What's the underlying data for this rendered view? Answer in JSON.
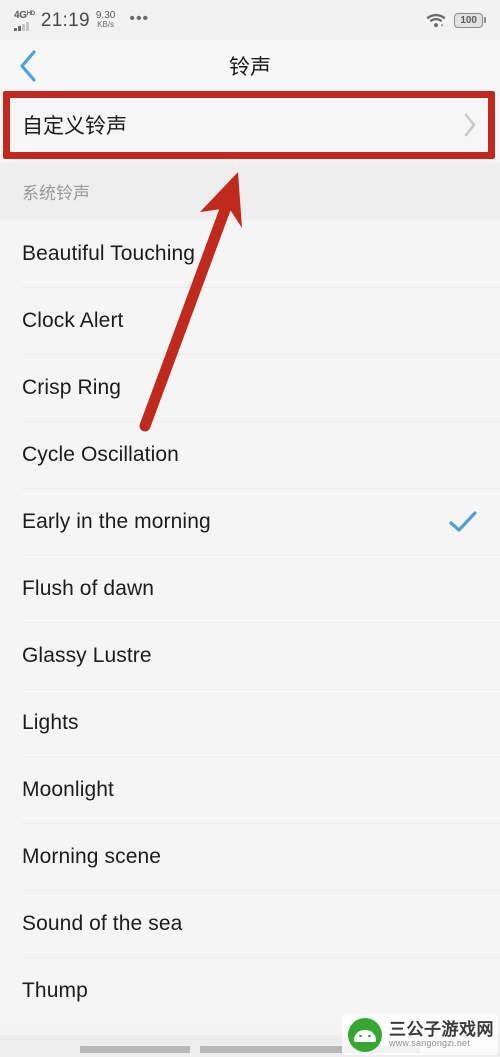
{
  "status_bar": {
    "network_type": "4G",
    "network_sup": "HD",
    "time": "21:19",
    "net_speed_value": "9.30",
    "net_speed_unit": "KB/s",
    "overflow_dots": "•••",
    "wifi_icon": "wifi-icon",
    "battery_level": "100"
  },
  "app_bar": {
    "back_icon": "chevron-left-icon",
    "title": "铃声"
  },
  "custom_ringtone": {
    "label": "自定义铃声",
    "chevron_icon": "chevron-right-icon",
    "highlight_color": "#c1281e"
  },
  "section": {
    "header": "系统铃声"
  },
  "ringtones": [
    {
      "name": "Beautiful Touching",
      "selected": false
    },
    {
      "name": "Clock Alert",
      "selected": false
    },
    {
      "name": "Crisp Ring",
      "selected": false
    },
    {
      "name": "Cycle Oscillation",
      "selected": false
    },
    {
      "name": "Early in the morning",
      "selected": true
    },
    {
      "name": "Flush of dawn",
      "selected": false
    },
    {
      "name": "Glassy Lustre",
      "selected": false
    },
    {
      "name": "Lights",
      "selected": false
    },
    {
      "name": "Moonlight",
      "selected": false
    },
    {
      "name": "Morning scene",
      "selected": false
    },
    {
      "name": "Sound of the sea",
      "selected": false
    },
    {
      "name": "Thump",
      "selected": false
    }
  ],
  "selection": {
    "checkmark_icon": "check-icon",
    "checkmark_color": "#4d9fd6"
  },
  "annotation": {
    "arrow_icon": "arrow-up-right-icon",
    "arrow_color": "#bf2a1c"
  },
  "watermark": {
    "logo_icon": "android-robot-icon",
    "site_name": "三公子游戏网",
    "site_url": "www.sangongzi.net"
  },
  "nav_bar": {
    "pills": [
      "recents-bar",
      "home-bar",
      "back-bar"
    ]
  }
}
